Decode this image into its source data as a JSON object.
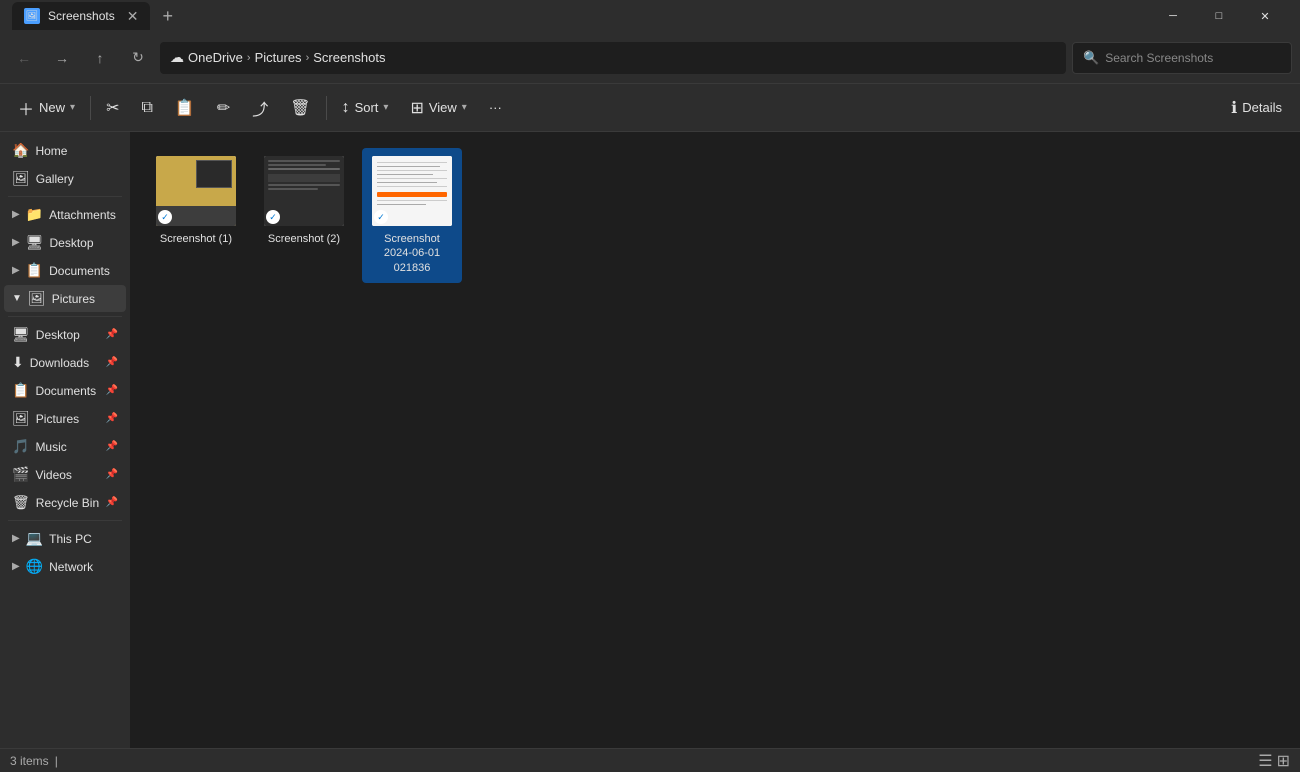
{
  "titleBar": {
    "tab": {
      "label": "Screenshots",
      "icon": "🖼"
    },
    "newTabSymbol": "+",
    "minimize": "─",
    "maximize": "□",
    "close": "✕"
  },
  "addressBar": {
    "back": "←",
    "forward": "→",
    "up": "↑",
    "refresh": "↻",
    "breadcrumb": {
      "onedrive": "OneDrive",
      "sep1": ">",
      "pictures": "Pictures",
      "sep2": ">",
      "screenshots": "Screenshots"
    },
    "search": {
      "placeholder": "Search Screenshots",
      "icon": "🔍"
    }
  },
  "toolbar": {
    "new": "New",
    "newIcon": "＋",
    "cut": "✂",
    "copy": "⧉",
    "paste": "📋",
    "rename": "✏",
    "share": "⤴",
    "delete": "🗑",
    "sort": "Sort",
    "sortIcon": "↕",
    "view": "View",
    "viewIcon": "⊞",
    "more": "···",
    "details": "Details",
    "detailsIcon": "ℹ"
  },
  "sidebar": {
    "home": {
      "label": "Home",
      "icon": "🏠"
    },
    "gallery": {
      "label": "Gallery",
      "icon": "🖼"
    },
    "items": [
      {
        "label": "Attachments",
        "icon": "📁",
        "color": "#ffc107",
        "hasArrow": true
      },
      {
        "label": "Desktop",
        "icon": "🖥",
        "color": "#4fc3f7",
        "hasArrow": true
      },
      {
        "label": "Documents",
        "icon": "📋",
        "color": "#4fc3f7",
        "hasArrow": true
      },
      {
        "label": "Pictures",
        "icon": "🖼",
        "color": "#7e57c2",
        "hasArrow": true,
        "active": true
      }
    ],
    "pinned": [
      {
        "label": "Desktop",
        "icon": "🖥",
        "color": "#4fc3f7",
        "pinned": true
      },
      {
        "label": "Downloads",
        "icon": "⬇",
        "color": "#4fc3f7",
        "pinned": true
      },
      {
        "label": "Documents",
        "icon": "📋",
        "color": "#4fc3f7",
        "pinned": true
      },
      {
        "label": "Pictures",
        "icon": "🖼",
        "color": "#7e57c2",
        "pinned": true
      },
      {
        "label": "Music",
        "icon": "🎵",
        "color": "#ef5350",
        "pinned": true
      },
      {
        "label": "Videos",
        "icon": "🎬",
        "color": "#7e57c2",
        "pinned": true
      },
      {
        "label": "Recycle Bin",
        "icon": "🗑",
        "color": "#aaa",
        "pinned": true
      }
    ],
    "thisPC": {
      "label": "This PC",
      "icon": "💻",
      "hasArrow": true
    },
    "network": {
      "label": "Network",
      "icon": "🌐",
      "hasArrow": true
    }
  },
  "files": [
    {
      "name": "Screenshot (1)",
      "type": "thumb1",
      "checkmark": "✓"
    },
    {
      "name": "Screenshot (2)",
      "type": "thumb2",
      "checkmark": "✓"
    },
    {
      "name": "Screenshot\n2024-06-01\n021836",
      "type": "thumb3",
      "checkmark": "✓",
      "selected": true
    }
  ],
  "statusBar": {
    "count": "3 items",
    "separator": "|",
    "viewIcons": {
      "list": "☰",
      "grid": "⊞"
    }
  }
}
